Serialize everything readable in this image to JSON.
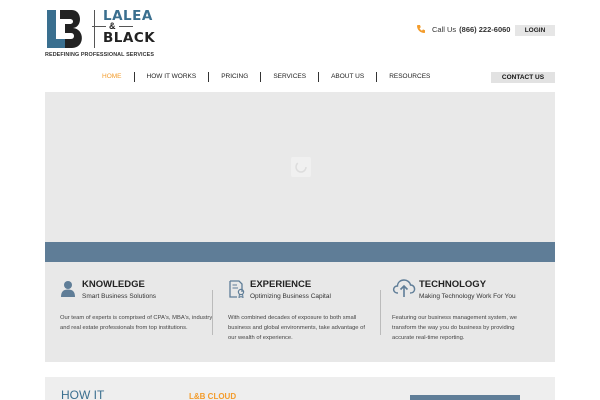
{
  "brand": {
    "word1": "LALEA",
    "amp": "&",
    "word2": "BLACK",
    "tagline": "REDEFINING PROFESSIONAL SERVICES",
    "mark_letters": "LB",
    "colors": {
      "primary": "#3a6f8f",
      "dark": "#222222"
    }
  },
  "header": {
    "call_label": "Call Us",
    "phone": "(866) 222-6060",
    "login_label": "LOGIN",
    "phone_icon": "phone-icon",
    "accent": "#f39c2c"
  },
  "nav": {
    "items": [
      {
        "label": "HOME",
        "active": true
      },
      {
        "label": "HOW IT WORKS",
        "active": false
      },
      {
        "label": "PRICING",
        "active": false
      },
      {
        "label": "SERVICES",
        "active": false
      },
      {
        "label": "ABOUT US",
        "active": false
      },
      {
        "label": "RESOURCES",
        "active": false
      }
    ],
    "contact_label": "CONTACT US"
  },
  "hero": {
    "loading": true,
    "bar_color": "#5f7d97"
  },
  "features": [
    {
      "icon": "user-icon",
      "title": "KNOWLEDGE",
      "subtitle": "Smart Business Solutions",
      "description": "Our team of experts is comprised of CPA's, MBA's, industry and real estate professionals from top institutions."
    },
    {
      "icon": "certificate-icon",
      "title": "EXPERIENCE",
      "subtitle": "Optimizing Business Capital",
      "description": "With combined decades of exposure to both small business and global environments, take advantage of our wealth of experience."
    },
    {
      "icon": "cloud-upload-icon",
      "title": "TECHNOLOGY",
      "subtitle": "Making Technology Work For You",
      "description": "Featuring our business management system, we transform the way you do business by providing accurate real-time reporting."
    }
  ],
  "bottom": {
    "how_title": "HOW IT",
    "cloud_title": "L&B CLOUD"
  }
}
